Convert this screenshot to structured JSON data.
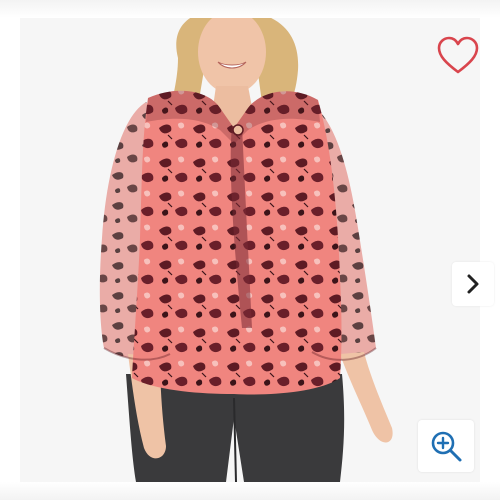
{
  "viewer": {
    "favorite_icon": "heart-outline-icon",
    "next_icon": "chevron-right-icon",
    "zoom_icon": "zoom-in-icon"
  },
  "colors": {
    "heart": "#d9454d",
    "zoom": "#1f6fb3",
    "chevron": "#222222",
    "blouse_base": "#f0857f",
    "blouse_leaf": "#5e1b24",
    "pants": "#3a3a3c"
  }
}
